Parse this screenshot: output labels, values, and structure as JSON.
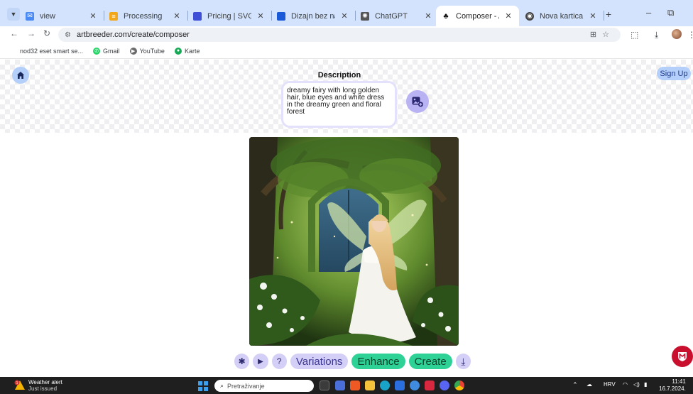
{
  "browser": {
    "tabs": [
      {
        "label": "view",
        "favicon": "mail-icon",
        "favicon_color": "#4a8af4"
      },
      {
        "label": "Processing",
        "favicon": "list-icon",
        "favicon_color": "#f2a81d"
      },
      {
        "label": "Pricing | SVG.io",
        "favicon": "svgio-icon",
        "favicon_color": "#3d4fd6"
      },
      {
        "label": "Dizajn bez naslova –",
        "favicon": "canva-icon",
        "favicon_color": "#1a5ad8"
      },
      {
        "label": "ChatGPT",
        "favicon": "chatgpt-icon",
        "favicon_color": "#555555"
      },
      {
        "label": "Composer - Artbree",
        "favicon": "artbreeder-icon",
        "favicon_color": "#111111",
        "active": true
      },
      {
        "label": "Nova kartica",
        "favicon": "chrome-icon",
        "favicon_color": "#444444"
      }
    ],
    "url": "artbreeder.com/create/composer",
    "bookmarks": [
      {
        "label": "nod32 eset smart se...",
        "icon": "bookmark-icon",
        "color": "#ffffff"
      },
      {
        "label": "Gmail",
        "icon": "whatsapp-icon",
        "color": "#25d366"
      },
      {
        "label": "YouTube",
        "icon": "youtube-icon",
        "color": "#6b6b6b"
      },
      {
        "label": "Karte",
        "icon": "maps-icon",
        "color": "#18a957"
      }
    ]
  },
  "page": {
    "description_title": "Description",
    "description_text": "dreamy fairy with long golden hair, blue eyes and white dress in the dreamy green and floral forest",
    "signup_label": "Sign Up",
    "toolbar": {
      "settings_symbol": "✱",
      "play_symbol": "▶",
      "help_symbol": "?",
      "variations_label": "Variations",
      "enhance_label": "Enhance",
      "create_label": "Create",
      "download_symbol": "⤓"
    },
    "colors": {
      "accent_lavender": "#d4cff6",
      "accent_green": "#2ed296",
      "accent_blue": "#b4cff9"
    }
  },
  "taskbar": {
    "weather_title": "Weather alert",
    "weather_sub": "Just issued",
    "weather_badge": "1",
    "search_placeholder": "Pretraživanje",
    "language": "HRV",
    "time": "11:41",
    "date": "16.7.2024."
  }
}
